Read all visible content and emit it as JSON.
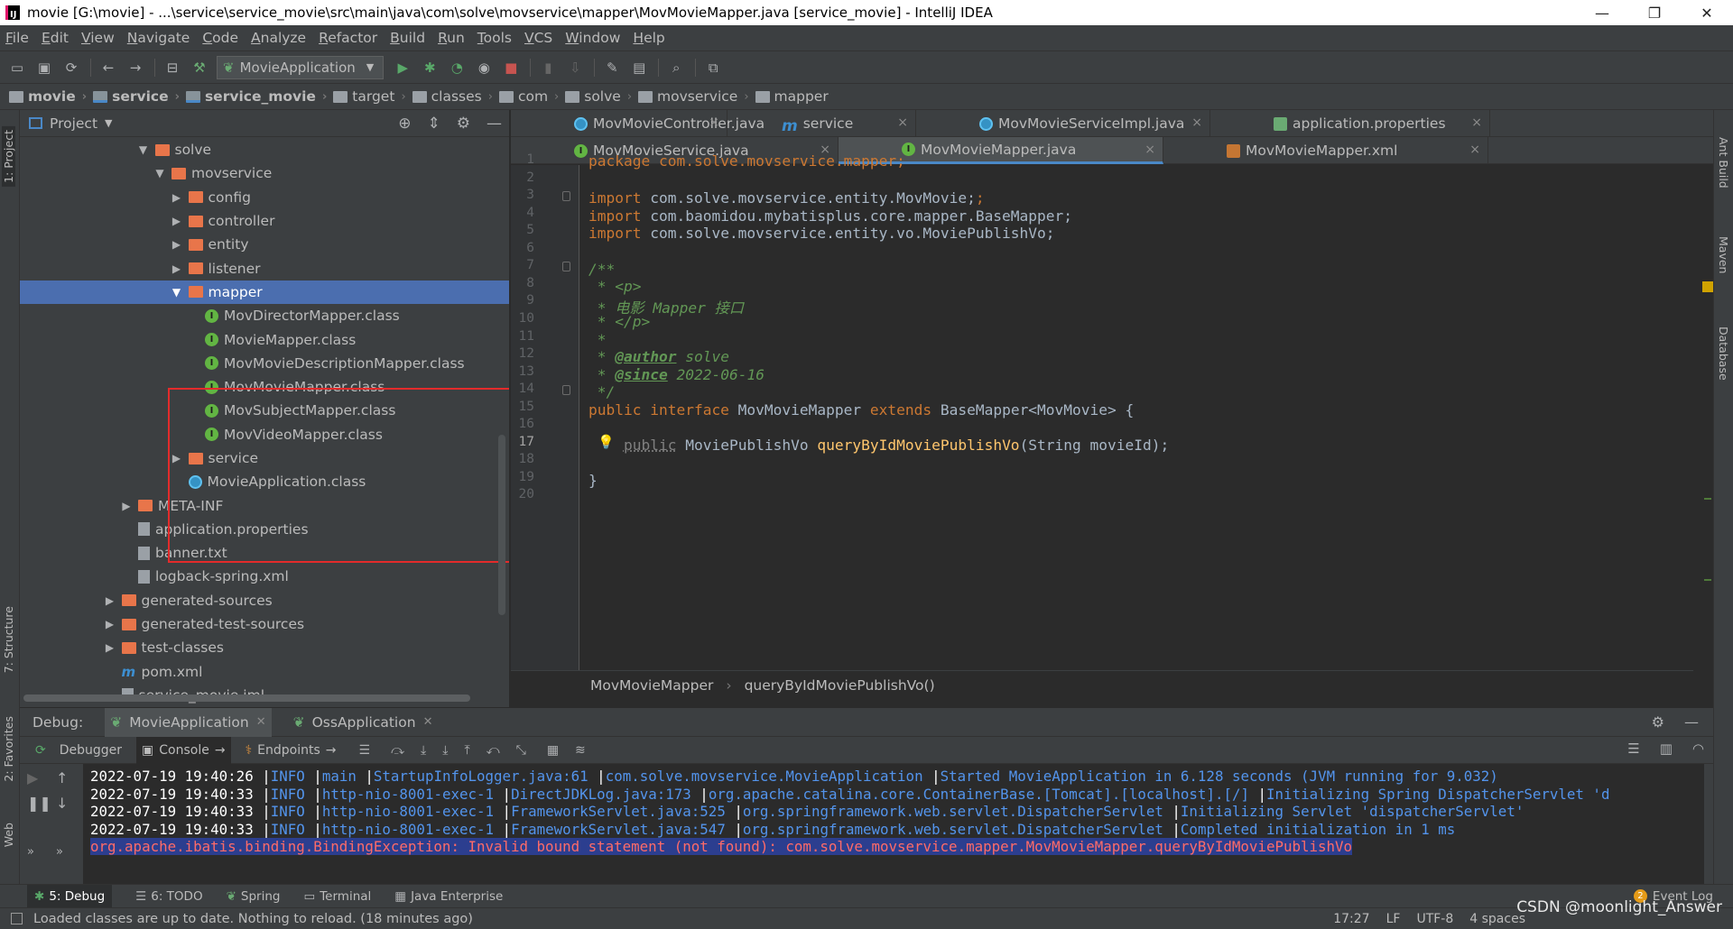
{
  "window": {
    "title": "movie [G:\\movie] - ...\\service\\service_movie\\src\\main\\java\\com\\solve\\movservice\\mapper\\MovMovieMapper.java [service_movie] - IntelliJ IDEA",
    "app_icon": "IJ",
    "buttons": [
      "—",
      "❐",
      "✕"
    ]
  },
  "menubar": [
    "File",
    "Edit",
    "View",
    "Navigate",
    "Code",
    "Analyze",
    "Refactor",
    "Build",
    "Run",
    "Tools",
    "VCS",
    "Window",
    "Help"
  ],
  "toolbar": {
    "run_config": "MovieApplication"
  },
  "navbar": {
    "crumbs": [
      "movie",
      "service",
      "service_movie",
      "target",
      "classes",
      "com",
      "solve",
      "movservice",
      "mapper"
    ]
  },
  "left_strip": {
    "project_tab": "1: Project",
    "structure_tab": "7: Structure",
    "favorites_tab": "2: Favorites",
    "web_tab": "Web"
  },
  "right_strip": {
    "ant_tab": "Ant Build",
    "maven_tab": "Maven",
    "database_tab": "Database"
  },
  "project_panel": {
    "title": "Project",
    "tree": [
      {
        "label": "solve",
        "indent": 7,
        "arrow": "▼",
        "icon": "folder"
      },
      {
        "label": "movservice",
        "indent": 8,
        "arrow": "▼",
        "icon": "folder"
      },
      {
        "label": "config",
        "indent": 9,
        "arrow": "▶",
        "icon": "folder"
      },
      {
        "label": "controller",
        "indent": 9,
        "arrow": "▶",
        "icon": "folder"
      },
      {
        "label": "entity",
        "indent": 9,
        "arrow": "▶",
        "icon": "folder"
      },
      {
        "label": "listener",
        "indent": 9,
        "arrow": "▶",
        "icon": "folder"
      },
      {
        "label": "mapper",
        "indent": 9,
        "arrow": "▼",
        "icon": "folder",
        "selected": true
      },
      {
        "label": "MovDirectorMapper.class",
        "indent": 10,
        "arrow": "",
        "icon": "iface"
      },
      {
        "label": "MovieMapper.class",
        "indent": 10,
        "arrow": "",
        "icon": "iface"
      },
      {
        "label": "MovMovieDescriptionMapper.class",
        "indent": 10,
        "arrow": "",
        "icon": "iface"
      },
      {
        "label": "MovMovieMapper.class",
        "indent": 10,
        "arrow": "",
        "icon": "iface"
      },
      {
        "label": "MovSubjectMapper.class",
        "indent": 10,
        "arrow": "",
        "icon": "iface"
      },
      {
        "label": "MovVideoMapper.class",
        "indent": 10,
        "arrow": "",
        "icon": "iface"
      },
      {
        "label": "service",
        "indent": 9,
        "arrow": "▶",
        "icon": "folder"
      },
      {
        "label": "MovieApplication.class",
        "indent": 9,
        "arrow": "",
        "icon": "cls"
      },
      {
        "label": "META-INF",
        "indent": 6,
        "arrow": "▶",
        "icon": "folder"
      },
      {
        "label": "application.properties",
        "indent": 6,
        "arrow": "",
        "icon": "file"
      },
      {
        "label": "banner.txt",
        "indent": 6,
        "arrow": "",
        "icon": "file"
      },
      {
        "label": "logback-spring.xml",
        "indent": 6,
        "arrow": "",
        "icon": "file"
      },
      {
        "label": "generated-sources",
        "indent": 5,
        "arrow": "▶",
        "icon": "folder"
      },
      {
        "label": "generated-test-sources",
        "indent": 5,
        "arrow": "▶",
        "icon": "folder"
      },
      {
        "label": "test-classes",
        "indent": 5,
        "arrow": "▶",
        "icon": "folder"
      },
      {
        "label": "pom.xml",
        "indent": 5,
        "arrow": "",
        "icon": "maven"
      },
      {
        "label": "service_movie.iml",
        "indent": 5,
        "arrow": "",
        "icon": "file"
      }
    ]
  },
  "editor": {
    "tabs_row1": [
      {
        "label": "MovMovieController.java",
        "icon": "c",
        "width": 240
      },
      {
        "label": "service",
        "icon": "m",
        "width": 209
      },
      {
        "label": "MovMovieServiceImpl.java",
        "icon": "c",
        "width": 326
      },
      {
        "label": "application.properties",
        "icon": "p",
        "width": 310
      }
    ],
    "tabs_row2": [
      {
        "label": "MovMovieService.java",
        "icon": "i",
        "width": 363
      },
      {
        "label": "MovMovieMapper.java",
        "icon": "i",
        "width": 360,
        "active": true
      },
      {
        "label": "MovMovieMapper.xml",
        "icon": "x",
        "width": 360
      }
    ],
    "line_numbers": [
      "1",
      "2",
      "3",
      "4",
      "5",
      "6",
      "7",
      "8",
      "9",
      "10",
      "11",
      "12",
      "13",
      "14",
      "15",
      "16",
      "17",
      "18",
      "19",
      "20"
    ],
    "current_line": "17",
    "code": {
      "l1": "package com.solve.movservice.mapper;",
      "l3_kw": "import",
      "l3": " com.solve.movservice.entity.MovMovie;",
      "l4": " com.baomidou.mybatisplus.core.mapper.BaseMapper;",
      "l5": " com.solve.movservice.entity.vo.MoviePublishVo;",
      "l7": "/**",
      "l8": " * <p>",
      "l9": " * 电影 Mapper 接口",
      "l10": " * </p>",
      "l11": " *",
      "l12_pre": " * ",
      "l12_tag": "@author",
      "l12_val": " solve",
      "l13_tag": "@since",
      "l13_val": " 2022-06-16",
      "l14": " */",
      "l15_kw1": "public interface",
      "l15_name": " MovMovieMapper ",
      "l15_kw2": "extends",
      "l15_rest": " BaseMapper<MovMovie> {",
      "l17_kw": "public",
      "l17_type": " MoviePublishVo ",
      "l17_fn": "queryByIdMoviePublishVo",
      "l17_rest": "(String movieId);",
      "l19": "}"
    },
    "breadcrumb": [
      "MovMovieMapper",
      "queryByIdMoviePublishVo()"
    ]
  },
  "debug": {
    "label": "Debug:",
    "tabs": [
      "MovieApplication",
      "OssApplication"
    ],
    "subtabs": [
      "Debugger",
      "Console",
      "Endpoints"
    ],
    "log": [
      {
        "ts": "2022-07-19 19:40:26",
        "level": "INFO",
        "thread": "main",
        "src": "StartupInfoLogger.java:61",
        "logger": "com.solve.movservice.MovieApplication",
        "msg": "Started MovieApplication in 6.128 seconds (JVM running for 9.032)"
      },
      {
        "ts": "2022-07-19 19:40:33",
        "level": "INFO",
        "thread": "http-nio-8001-exec-1",
        "src": "DirectJDKLog.java:173",
        "logger": "org.apache.catalina.core.ContainerBase.[Tomcat].[localhost].[/]",
        "msg": "Initializing Spring DispatcherServlet 'd"
      },
      {
        "ts": "2022-07-19 19:40:33",
        "level": "INFO",
        "thread": "http-nio-8001-exec-1",
        "src": "FrameworkServlet.java:525",
        "logger": "org.springframework.web.servlet.DispatcherServlet",
        "msg": "Initializing Servlet 'dispatcherServlet'"
      },
      {
        "ts": "2022-07-19 19:40:33",
        "level": "INFO",
        "thread": "http-nio-8001-exec-1",
        "src": "FrameworkServlet.java:547",
        "logger": "org.springframework.web.servlet.DispatcherServlet",
        "msg": "Completed initialization in 1 ms"
      }
    ],
    "error": "org.apache.ibatis.binding.BindingException: Invalid bound statement (not found): com.solve.movservice.mapper.MovMovieMapper.queryByIdMoviePublishVo"
  },
  "bottombar": {
    "tools": [
      "5: Debug",
      "6: TODO",
      "Spring",
      "Terminal",
      "Java Enterprise"
    ],
    "event_log": "Event Log",
    "event_count": "2"
  },
  "statusbar": {
    "message": "Loaded classes are up to date. Nothing to reload. (18 minutes ago)",
    "position": "17:27",
    "line_sep": "LF",
    "encoding": "UTF-8",
    "indent": "4 spaces"
  },
  "watermark": "CSDN @moonlight_Answer",
  "colors": {
    "keyword": "#cc7832",
    "doc": "#629755",
    "method": "#ffc66d",
    "selection": "#4b6eaf",
    "highlight_box": "#e32b2b"
  }
}
